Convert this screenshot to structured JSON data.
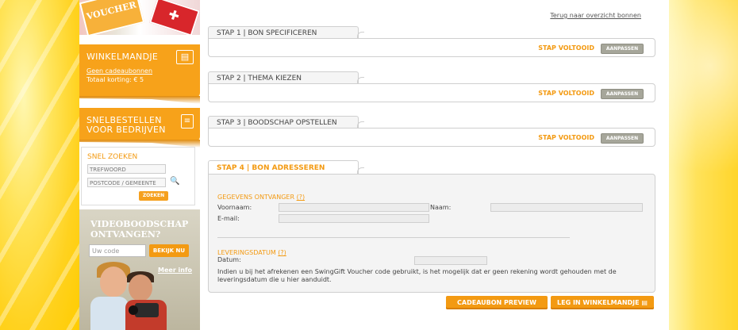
{
  "back_link": "Terug naar overzicht bonnen",
  "voucher_card_text": "VOUCHER",
  "sidebar": {
    "winkelmandje": {
      "title": "WINKELMANDJE",
      "link": "Geen cadeaubonnen",
      "korting": "Totaal korting: € 5"
    },
    "snelbestellen": {
      "title": "SNELBESTELLEN VOOR BEDRIJVEN"
    },
    "zoeken": {
      "title": "SNEL ZOEKEN",
      "trefwoord_placeholder": "TREFWOORD",
      "postcode_placeholder": "POSTCODE / GEMEENTE",
      "button": "ZOEKEN"
    },
    "video": {
      "title": "VIDEOBOODSCHAP ONTVANGEN?",
      "code_placeholder": "Uw code",
      "button": "BEKIJK NU",
      "meer_info": "Meer info"
    }
  },
  "steps": [
    {
      "tab": "STAP 1 | BON SPECIFICEREN",
      "status": "STAP VOLTOOID",
      "button": "AANPASSEN"
    },
    {
      "tab": "STAP 2 | THEMA KIEZEN",
      "status": "STAP VOLTOOID",
      "button": "AANPASSEN"
    },
    {
      "tab": "STAP 3 | BOODSCHAP OPSTELLEN",
      "status": "STAP VOLTOOID",
      "button": "AANPASSEN"
    }
  ],
  "step4": {
    "tab": "STAP 4 | BON ADRESSEREN",
    "ontvanger_title": "GEGEVENS ONTVANGER",
    "ontvanger_help": "(?)",
    "voornaam_label": "Voornaam:",
    "naam_label": "Naam:",
    "email_label": "E-mail:",
    "levering_title": "LEVERINGSDATUM",
    "levering_help": "(?)",
    "datum_label": "Datum:",
    "info": "Indien u bij het afrekenen een SwingGift Voucher code gebruikt, is het mogelijk dat er geen rekening wordt gehouden met de leveringsdatum die u hier aanduidt."
  },
  "buttons": {
    "preview": "CADEAUBON PREVIEW",
    "cart": "LEG IN WINKELMANDJE"
  },
  "colors": {
    "accent": "#f39a12",
    "sidebar_panel": "#f7a21a",
    "button_grey": "#a6a69a"
  }
}
